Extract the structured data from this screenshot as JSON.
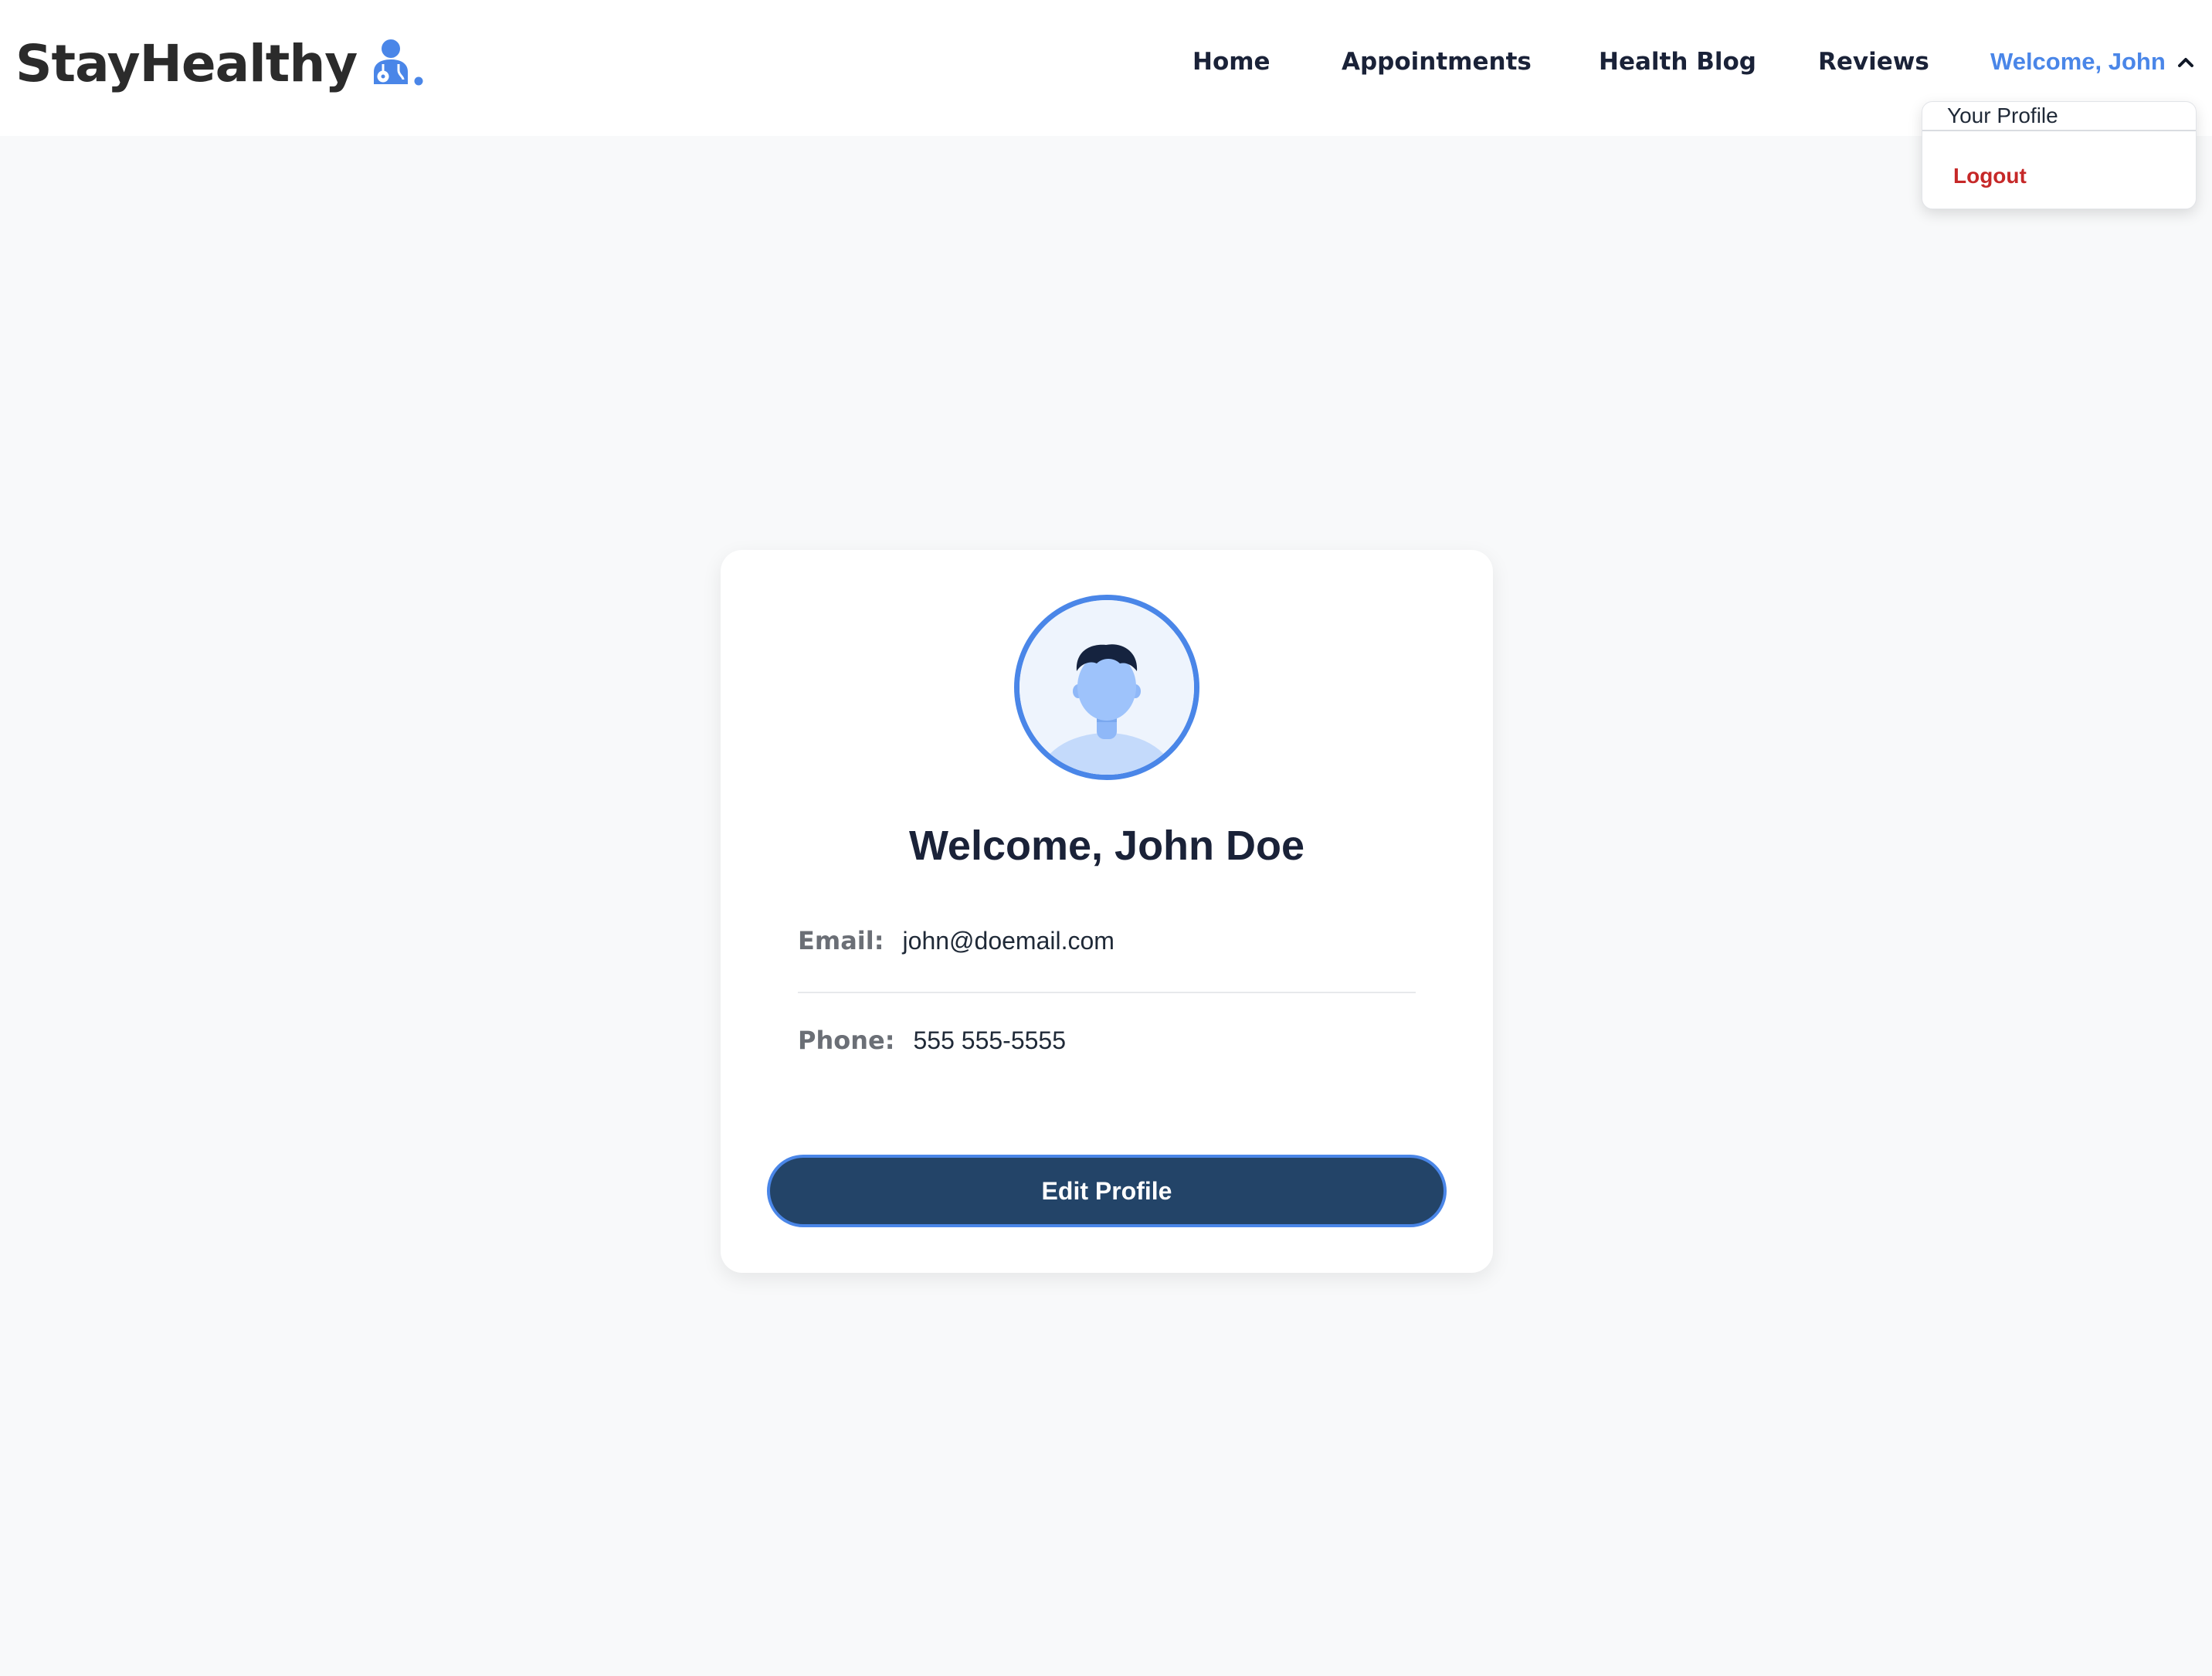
{
  "brand": {
    "name": "StayHealthy",
    "icon": "doctor-icon",
    "accent_color": "#4a86e8"
  },
  "nav": {
    "links": [
      {
        "label": "Home"
      },
      {
        "label": "Appointments"
      },
      {
        "label": "Health Blog"
      },
      {
        "label": "Reviews"
      }
    ],
    "welcome_label": "Welcome, John",
    "welcome_icon": "chevron-up-icon",
    "welcome_color": "#4a86e8"
  },
  "dropdown": {
    "open": true,
    "items": [
      {
        "label": "Your Profile"
      },
      {
        "label": "Logout",
        "color": "#c62828"
      }
    ]
  },
  "profile": {
    "avatar_icon": "user-avatar-icon",
    "title": "Welcome, John Doe",
    "fields": [
      {
        "label": "Email:",
        "value": "john@doemail.com"
      },
      {
        "label": "Phone:",
        "value": "555 555-5555"
      }
    ],
    "edit_button_label": "Edit Profile",
    "button_color": "#234468"
  }
}
